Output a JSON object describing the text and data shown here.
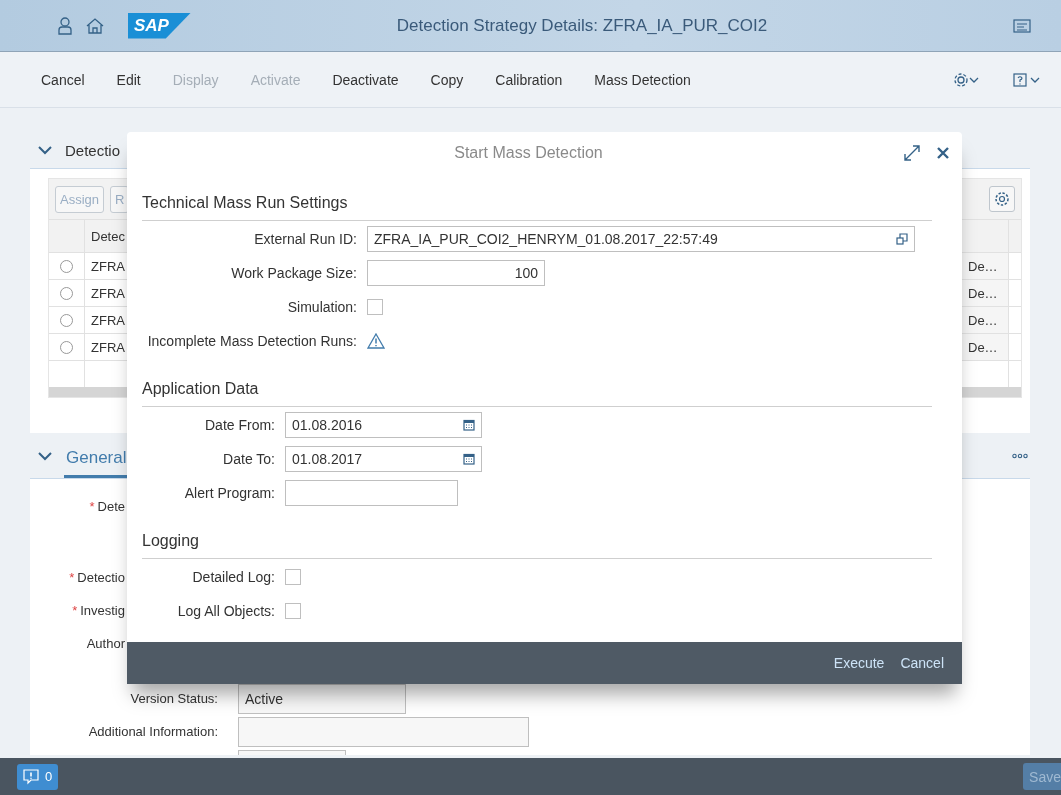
{
  "shell": {
    "logo": "SAP",
    "title": "Detection Strategy Details: ZFRA_IA_PUR_COI2"
  },
  "toolbar": {
    "actions": [
      {
        "label": "Cancel",
        "disabled": false
      },
      {
        "label": "Edit",
        "disabled": false
      },
      {
        "label": "Display",
        "disabled": true
      },
      {
        "label": "Activate",
        "disabled": true
      },
      {
        "label": "Deactivate",
        "disabled": false
      },
      {
        "label": "Copy",
        "disabled": false
      },
      {
        "label": "Calibration",
        "disabled": false
      },
      {
        "label": "Mass Detection",
        "disabled": false
      }
    ]
  },
  "detection_section": {
    "title": "Detectio",
    "expanded": true,
    "buttons": [
      {
        "label": "Assign",
        "disabled": true
      },
      {
        "label": "R",
        "disabled": true
      }
    ],
    "table": {
      "columns": [
        "Detec"
      ],
      "rows": [
        {
          "selected": false,
          "column_1": "ZFRA",
          "column_last": "De…"
        },
        {
          "selected": false,
          "column_1": "ZFRA",
          "column_last": "De…"
        },
        {
          "selected": false,
          "column_1": "ZFRA",
          "column_last": "De…"
        },
        {
          "selected": false,
          "column_1": "ZFRA",
          "column_last": "De…"
        }
      ]
    }
  },
  "general_section": {
    "title": "General",
    "expanded": true,
    "selected": true,
    "fields": [
      {
        "required_mark": "*",
        "label": "Dete"
      },
      {
        "required_mark": "*",
        "label": "Detectio"
      },
      {
        "required_mark": "*",
        "label": "Investig"
      },
      {
        "label": "Author"
      }
    ],
    "version_status": {
      "label": "Version Status:",
      "value": "Active",
      "disabled": true
    },
    "additional_information": {
      "label": "Additional Information:"
    }
  },
  "dialog": {
    "title": "Start Mass Detection",
    "sections": [
      {
        "title": "Technical Mass Run Settings",
        "rows": [
          {
            "kind": "valuehelp",
            "label": "External Run ID:",
            "value": "ZFRA_IA_PUR_COI2_HENRYM_01.08.2017_22:57:49"
          },
          {
            "kind": "number",
            "label": "Work Package Size:",
            "value": "100"
          },
          {
            "kind": "checkbox",
            "label": "Simulation:",
            "checked": false
          },
          {
            "kind": "warning",
            "label": "Incomplete Mass Detection Runs:"
          }
        ]
      },
      {
        "title": "Application Data",
        "rows": [
          {
            "kind": "date",
            "label": "Date From:",
            "value": "01.08.2016"
          },
          {
            "kind": "date",
            "label": "Date To:",
            "value": "01.08.2017"
          },
          {
            "kind": "text",
            "label": "Alert Program:"
          }
        ]
      },
      {
        "title": "Logging",
        "rows": [
          {
            "kind": "checkbox",
            "label": "Detailed Log:",
            "checked": false
          },
          {
            "kind": "checkbox",
            "label": "Log All Objects:",
            "checked": false
          }
        ]
      }
    ],
    "footer_buttons": [
      "Execute",
      "Cancel"
    ]
  },
  "status_bar": {
    "messages": "0",
    "save": {
      "label": "Save",
      "disabled": true
    }
  }
}
